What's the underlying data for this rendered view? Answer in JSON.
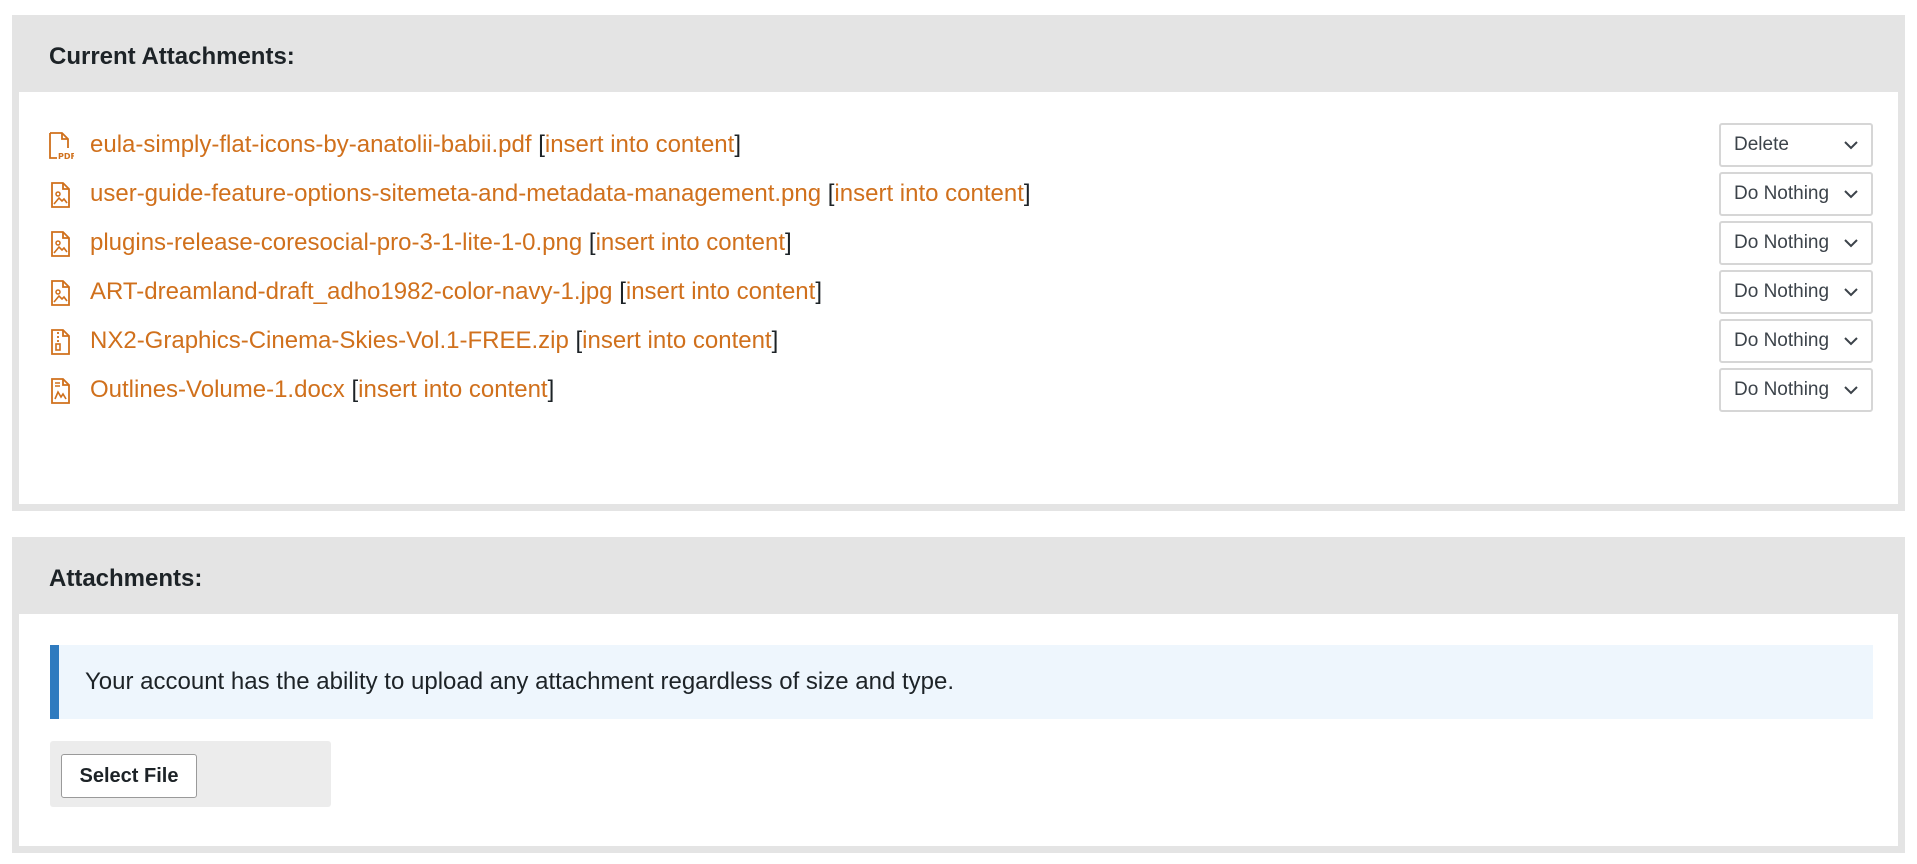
{
  "current_attachments": {
    "title": "Current Attachments:",
    "items": [
      {
        "icon": "pdf-file-icon",
        "filename": "eula-simply-flat-icons-by-anatolii-babii.pdf",
        "insert_label": "insert into content",
        "action": "Delete"
      },
      {
        "icon": "image-file-icon",
        "filename": "user-guide-feature-options-sitemeta-and-metadata-management.png",
        "insert_label": "insert into content",
        "action": "Do Nothing"
      },
      {
        "icon": "image-file-icon",
        "filename": "plugins-release-coresocial-pro-3-1-lite-1-0.png",
        "insert_label": "insert into content",
        "action": "Do Nothing"
      },
      {
        "icon": "image-file-icon",
        "filename": "ART-dreamland-draft_adho1982-color-navy-1.jpg",
        "insert_label": "insert into content",
        "action": "Do Nothing"
      },
      {
        "icon": "zip-file-icon",
        "filename": "NX2-Graphics-Cinema-Skies-Vol.1-FREE.zip",
        "insert_label": "insert into content",
        "action": "Do Nothing"
      },
      {
        "icon": "document-file-icon",
        "filename": "Outlines-Volume-1.docx",
        "insert_label": "insert into content",
        "action": "Do Nothing"
      }
    ]
  },
  "attachments": {
    "title": "Attachments:",
    "notice": "Your account has the ability to upload any attachment regardless of size and type.",
    "select_file_label": "Select File"
  },
  "colors": {
    "link": "#d0701c",
    "panel_border": "#e4e4e4",
    "notice_bg": "#eef6fd",
    "notice_accent": "#2f7bbf"
  }
}
